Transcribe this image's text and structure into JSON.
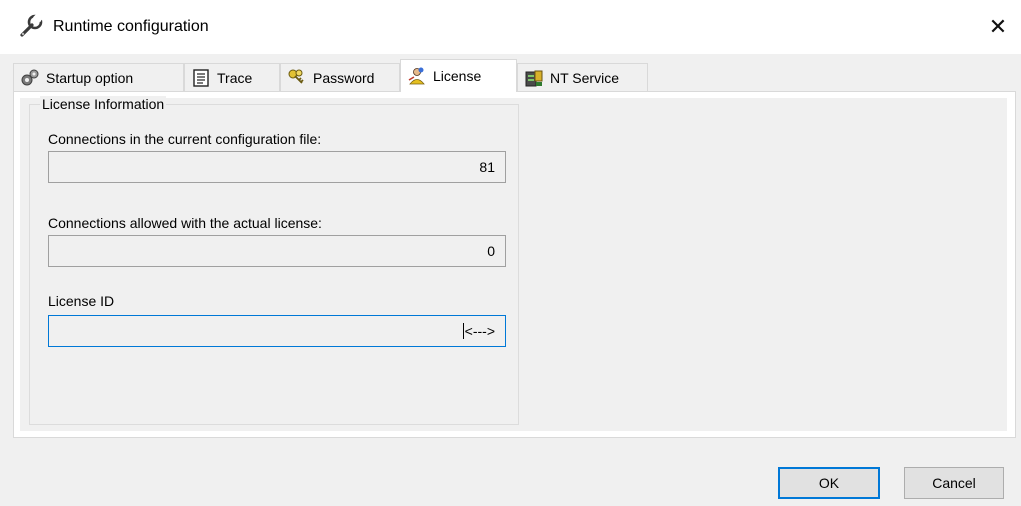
{
  "window": {
    "title": "Runtime configuration",
    "close_symbol": "✕",
    "icon": "wrench-icon"
  },
  "tabs": [
    {
      "label": "Startup option",
      "icon": "gears-icon",
      "active": false
    },
    {
      "label": "Trace",
      "icon": "notepad-icon",
      "active": false
    },
    {
      "label": "Password",
      "icon": "keys-icon",
      "active": false
    },
    {
      "label": "License",
      "icon": "license-user-icon",
      "active": true
    },
    {
      "label": "NT Service",
      "icon": "server-icon",
      "active": false
    }
  ],
  "license": {
    "group_title": "License Information",
    "connections_config_label": "Connections in the current configuration file:",
    "connections_config_value": "81",
    "connections_allowed_label": "Connections allowed with the actual license:",
    "connections_allowed_value": "0",
    "license_id_label": "License ID",
    "license_id_value": "<--->"
  },
  "buttons": {
    "ok": "OK",
    "cancel": "Cancel"
  },
  "colors": {
    "focus_accent": "#0078d7",
    "dialog_bg": "#f0f0f0"
  }
}
